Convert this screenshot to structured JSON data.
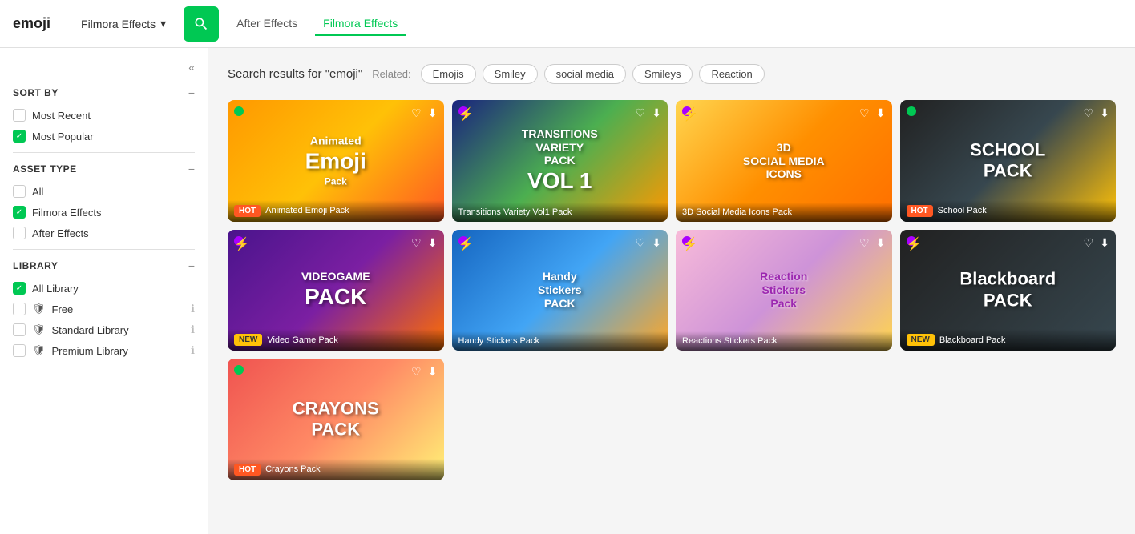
{
  "header": {
    "logo": "emoji",
    "dropdown": "Filmora Effects",
    "search_button": "search",
    "tabs": [
      {
        "label": "After Effects",
        "active": false
      },
      {
        "label": "Filmora Effects",
        "active": true
      }
    ]
  },
  "sidebar": {
    "collapse_label": "«",
    "sort_by": {
      "title": "SORT BY",
      "options": [
        {
          "label": "Most Recent",
          "checked": false
        },
        {
          "label": "Most Popular",
          "checked": true
        }
      ]
    },
    "asset_type": {
      "title": "ASSET TYPE",
      "options": [
        {
          "label": "All",
          "checked": false
        },
        {
          "label": "Filmora Effects",
          "checked": true
        },
        {
          "label": "After Effects",
          "checked": false
        }
      ]
    },
    "library": {
      "title": "LIBRARY",
      "options": [
        {
          "label": "All Library",
          "checked": true,
          "icon": "none"
        },
        {
          "label": "Free",
          "checked": false,
          "icon": "shield"
        },
        {
          "label": "Standard Library",
          "checked": false,
          "icon": "shield"
        },
        {
          "label": "Premium Library",
          "checked": false,
          "icon": "shield"
        }
      ]
    }
  },
  "content": {
    "search_title": "Search results for \"emoji\"",
    "related_label": "Related:",
    "tags": [
      "Emojis",
      "Smiley",
      "social media",
      "Smileys",
      "Reaction"
    ],
    "cards": [
      {
        "title": "Animated Emoji Pack",
        "badge": "HOT",
        "badge_type": "hot",
        "indicator": "green",
        "bg": "emoji",
        "inner": "Animated Emoji Pack"
      },
      {
        "title": "Transitions Variety Vol1 Pack",
        "badge": "",
        "badge_type": "",
        "indicator": "purple",
        "bg": "transitions",
        "inner": "TRANSITIONS VARIETY PACK VOL 1"
      },
      {
        "title": "3D Social Media Icons Pack",
        "badge": "",
        "badge_type": "",
        "indicator": "purple",
        "bg": "3d",
        "inner": "3D SOCIAL MEDIA ICONS"
      },
      {
        "title": "School Pack",
        "badge": "HOT",
        "badge_type": "hot",
        "indicator": "green",
        "bg": "school",
        "inner": "SCHOOL PACK"
      },
      {
        "title": "Video Game Pack",
        "badge": "NEW",
        "badge_type": "new",
        "indicator": "purple",
        "bg": "videogame",
        "inner": "VIDEOGAME PACK"
      },
      {
        "title": "Handy Stickers Pack",
        "badge": "",
        "badge_type": "",
        "indicator": "purple",
        "bg": "handy",
        "inner": "Handy Stickers PACK"
      },
      {
        "title": "Reactions Stickers Pack",
        "badge": "",
        "badge_type": "",
        "indicator": "purple",
        "bg": "reaction",
        "inner": "Reaction Stickers Pack"
      },
      {
        "title": "Blackboard Pack",
        "badge": "NEW",
        "badge_type": "new",
        "indicator": "purple",
        "bg": "blackboard",
        "inner": "Blackboard PACK"
      },
      {
        "title": "Crayons Pack",
        "badge": "HOT",
        "badge_type": "hot",
        "indicator": "green",
        "bg": "crayons",
        "inner": "CRAYONS PACK"
      }
    ]
  }
}
